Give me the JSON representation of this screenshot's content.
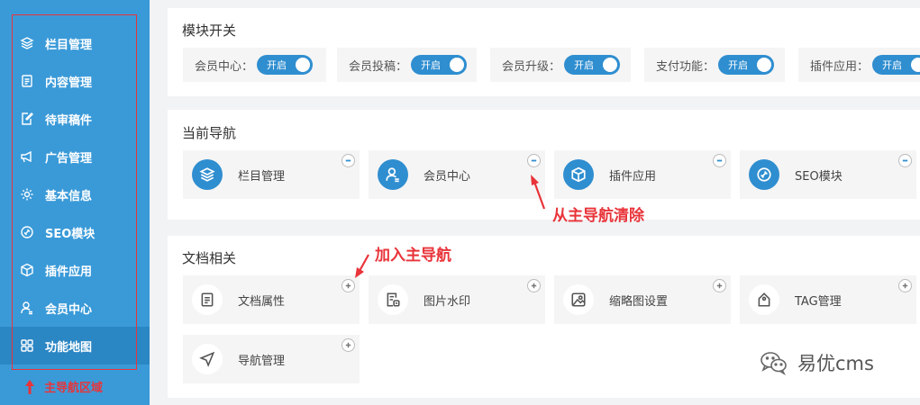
{
  "sidebar": {
    "items": [
      {
        "label": "栏目管理",
        "icon": "layers-icon"
      },
      {
        "label": "内容管理",
        "icon": "document-icon"
      },
      {
        "label": "待审稿件",
        "icon": "edit-document-icon"
      },
      {
        "label": "广告管理",
        "icon": "megaphone-icon"
      },
      {
        "label": "基本信息",
        "icon": "gear-icon"
      },
      {
        "label": "SEO模块",
        "icon": "seo-link-icon"
      },
      {
        "label": "插件应用",
        "icon": "cube-icon"
      },
      {
        "label": "会员中心",
        "icon": "user-icon"
      },
      {
        "label": "功能地图",
        "icon": "grid-icon",
        "active": true
      }
    ],
    "note": "主导航区域"
  },
  "module_switch": {
    "title": "模块开关",
    "toggles": [
      {
        "label": "会员中心：",
        "state": "开启"
      },
      {
        "label": "会员投稿：",
        "state": "开启"
      },
      {
        "label": "会员升级：",
        "state": "开启"
      },
      {
        "label": "支付功能：",
        "state": "开启"
      },
      {
        "label": "插件应用：",
        "state": "开启"
      }
    ]
  },
  "current_nav": {
    "title": "当前导航",
    "items": [
      {
        "label": "栏目管理",
        "icon": "layers-icon"
      },
      {
        "label": "会员中心",
        "icon": "user-icon"
      },
      {
        "label": "插件应用",
        "icon": "cube-icon"
      },
      {
        "label": "SEO模块",
        "icon": "seo-link-icon"
      }
    ],
    "annotation": "从主导航清除"
  },
  "doc_related": {
    "title": "文档相关",
    "items": [
      {
        "label": "文档属性",
        "icon": "document-icon"
      },
      {
        "label": "图片水印",
        "icon": "image-watermark-icon"
      },
      {
        "label": "缩略图设置",
        "icon": "picture-icon"
      },
      {
        "label": "TAG管理",
        "icon": "tag-icon"
      },
      {
        "label": "导航管理",
        "icon": "navigation-icon"
      }
    ],
    "annotation": "加入主导航"
  },
  "watermark": {
    "text": "易优cms",
    "icon": "wechat-icon"
  },
  "colors": {
    "sidebar": "#3a9ad8",
    "accent": "#2f8ed0",
    "annotation": "#e8343a"
  }
}
